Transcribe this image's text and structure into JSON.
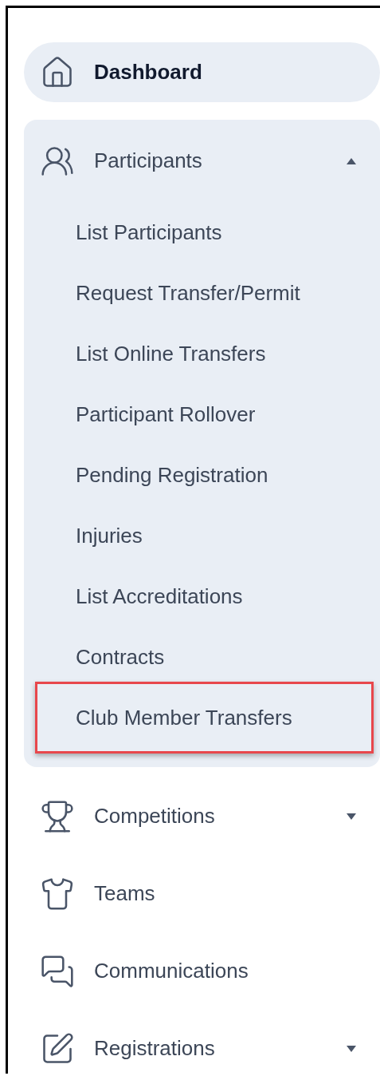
{
  "nav": [
    {
      "kind": "link",
      "label": "Dashboard",
      "selected": true
    },
    {
      "kind": "group",
      "label": "Participants",
      "selected": false,
      "expanded": true,
      "children": [
        {
          "label": "List Participants",
          "highlighted": false
        },
        {
          "label": "Request Transfer/Permit",
          "highlighted": false
        },
        {
          "label": "List Online Transfers",
          "highlighted": false
        },
        {
          "label": "Participant Rollover",
          "highlighted": false
        },
        {
          "label": "Pending Registration",
          "highlighted": false
        },
        {
          "label": "Injuries",
          "highlighted": false
        },
        {
          "label": "List Accreditations",
          "highlighted": false
        },
        {
          "label": "Contracts",
          "highlighted": false
        },
        {
          "label": "Club Member Transfers",
          "highlighted": true
        }
      ]
    },
    {
      "kind": "group",
      "label": "Competitions",
      "selected": false,
      "expanded": false
    },
    {
      "kind": "link",
      "label": "Teams",
      "selected": false
    },
    {
      "kind": "link",
      "label": "Communications",
      "selected": false
    },
    {
      "kind": "group",
      "label": "Registrations",
      "selected": false,
      "expanded": false
    }
  ]
}
